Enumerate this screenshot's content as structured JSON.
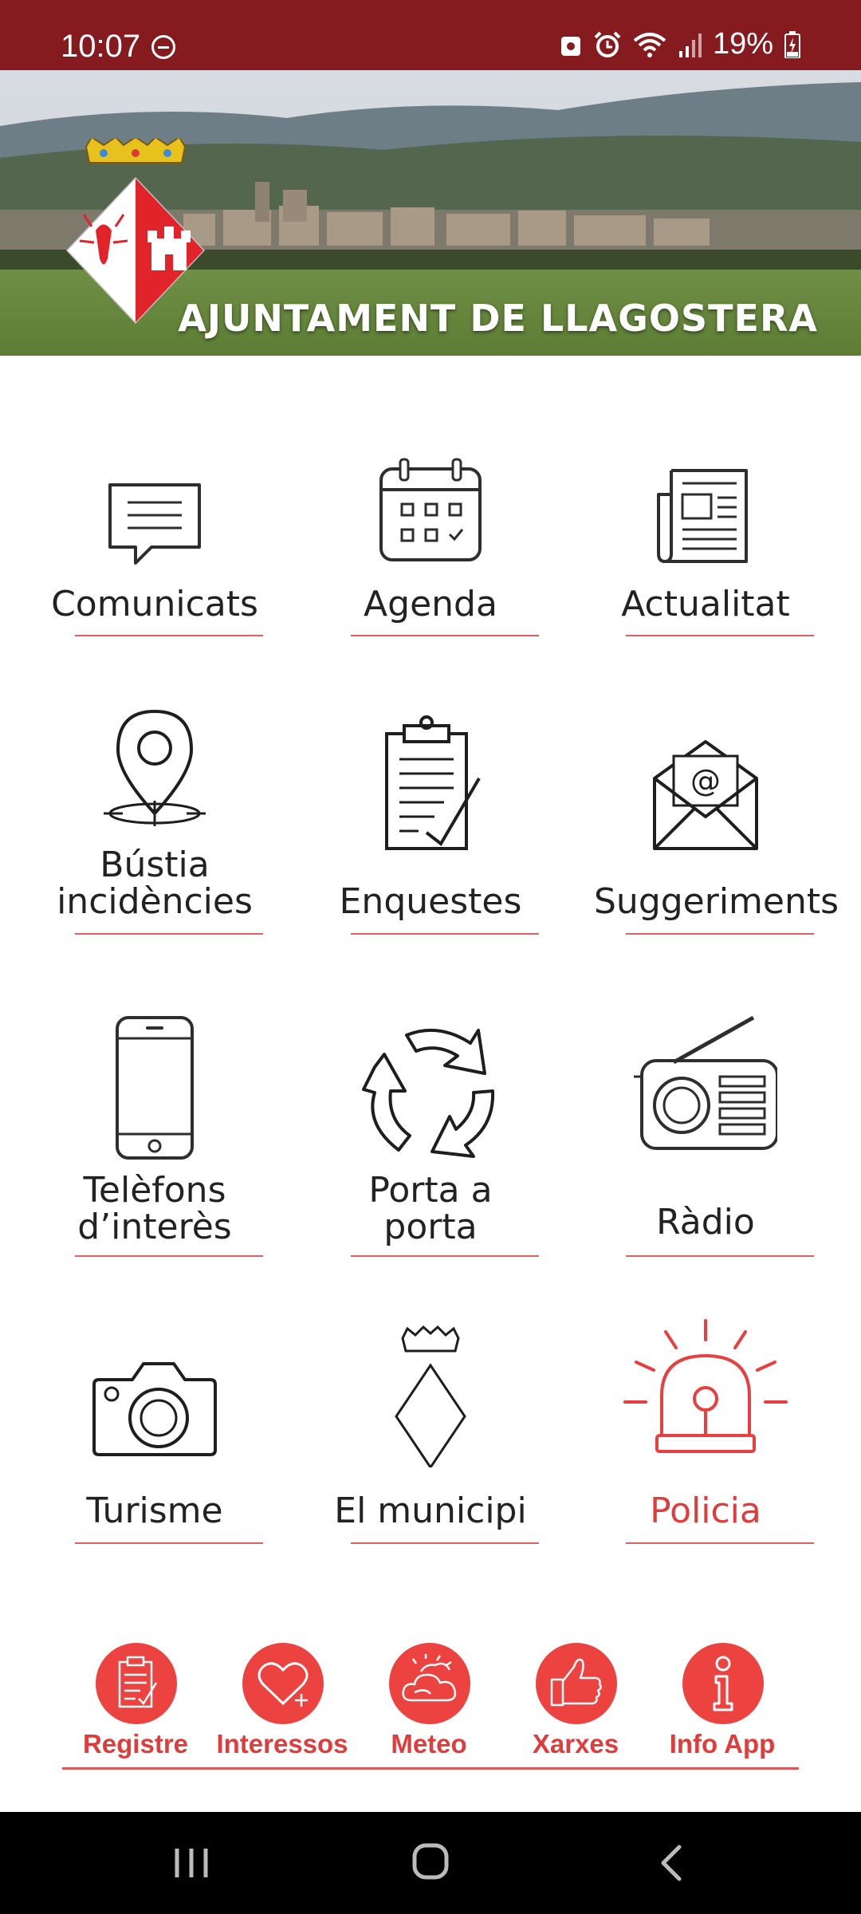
{
  "status_bar": {
    "time": "10:07",
    "battery": "19%"
  },
  "header": {
    "title": "AJUNTAMENT DE LLAGOSTERA"
  },
  "menu": [
    {
      "label": "Comunicats",
      "icon": "chat-message-icon"
    },
    {
      "label": "Agenda",
      "icon": "calendar-icon"
    },
    {
      "label": "Actualitat",
      "icon": "newspaper-icon"
    },
    {
      "label_lines": [
        "Bústia",
        "incidències"
      ],
      "icon": "map-pin-icon"
    },
    {
      "label": "Enquestes",
      "icon": "clipboard-check-icon"
    },
    {
      "label": "Suggeriments",
      "icon": "email-envelope-icon"
    },
    {
      "label_lines": [
        "Telèfons",
        "d’interès"
      ],
      "icon": "phone-icon"
    },
    {
      "label_lines": [
        "Porta a",
        "porta"
      ],
      "icon": "recycle-icon"
    },
    {
      "label": "Ràdio",
      "icon": "radio-icon"
    },
    {
      "label": "Turisme",
      "icon": "camera-icon"
    },
    {
      "label": "El municipi",
      "icon": "municipal-crest-icon"
    },
    {
      "label": "Policia",
      "icon": "police-siren-icon"
    }
  ],
  "bottom_bar": [
    {
      "label": "Registre",
      "icon": "register-clipboard-icon"
    },
    {
      "label": "Interessos",
      "icon": "heart-plus-icon"
    },
    {
      "label": "Meteo",
      "icon": "weather-sun-cloud-icon"
    },
    {
      "label": "Xarxes",
      "icon": "thumbs-up-icon"
    },
    {
      "label": "Info App",
      "icon": "info-icon"
    }
  ],
  "colors": {
    "status_bar": "#861b1f",
    "accent": "#e03c3c",
    "bottom_circle": "#ec4341"
  }
}
